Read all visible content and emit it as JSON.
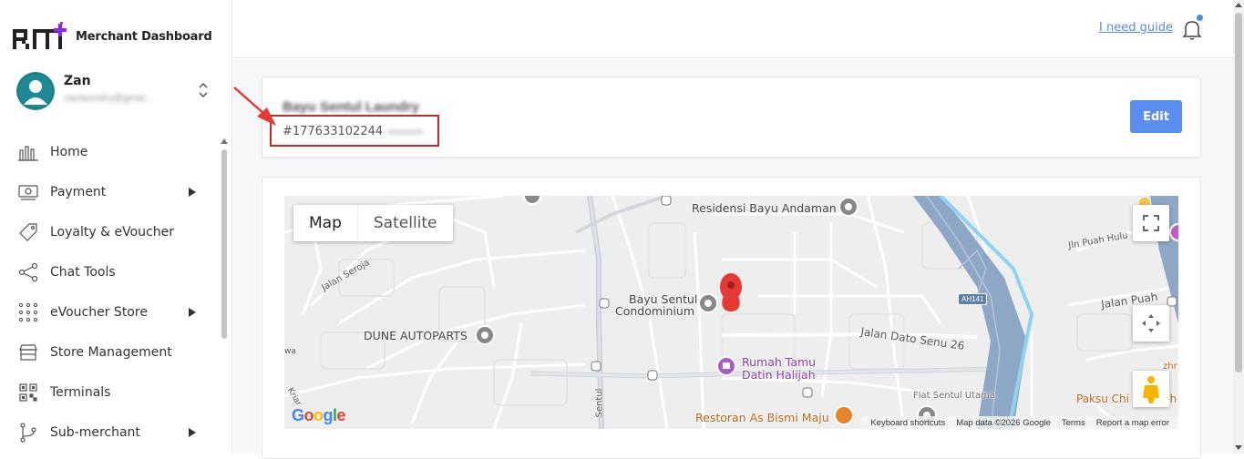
{
  "brand": {
    "logo_text": "RM",
    "name": "Merchant Dashboard"
  },
  "profile": {
    "name": "Zan",
    "email": "zanlaundry@gmai..."
  },
  "nav": [
    {
      "label": "Home",
      "icon": "chart-bars-icon",
      "has_caret": false
    },
    {
      "label": "Payment",
      "icon": "payment-icon",
      "has_caret": true
    },
    {
      "label": "Loyalty & eVoucher",
      "icon": "tag-icon",
      "has_caret": false
    },
    {
      "label": "Chat Tools",
      "icon": "share-icon",
      "has_caret": false
    },
    {
      "label": "eVoucher Store",
      "icon": "grid-dots-icon",
      "has_caret": true
    },
    {
      "label": "Store Management",
      "icon": "store-icon",
      "has_caret": false
    },
    {
      "label": "Terminals",
      "icon": "qr-icon",
      "has_caret": false
    },
    {
      "label": "Sub-merchant",
      "icon": "branch-icon",
      "has_caret": true
    }
  ],
  "header": {
    "guide_link": "I need guide",
    "notification_icon": "bell-icon"
  },
  "store": {
    "name": "Bayu Sentul Laundry",
    "id": "#177633102244",
    "id_suffix": "xxxxxxx",
    "edit_label": "Edit"
  },
  "map": {
    "types": [
      "Map",
      "Satellite"
    ],
    "selected_type": "Map",
    "labels": {
      "residensi": "Residensi Bayu Andaman",
      "jalan_seroja": "Jalan Seroja",
      "bayu_condo_1": "Bayu Sentul",
      "bayu_condo_2": "Condominium",
      "dune": "DUNE AUTOPARTS",
      "jalan_dato": "Jalan Dato Senu 26",
      "rumah_1": "Rumah Tamu",
      "rumah_2": "Datin Halijah",
      "restoran": "Restoran As Bismi Maju",
      "jalan_puah": "Jalan Puah",
      "jln_puah_hulu": "Jln Puah Hulu",
      "paksu": "Paksu Chi",
      "sentul": "Sentul",
      "ah141": "AH141",
      "kriar": "Kriar",
      "zhr": "zhr",
      "wa": "wa",
      "ch": "ch",
      "flat": "Flat Sentul Utama"
    },
    "footer": [
      "Keyboard shortcuts",
      "Map data ©2026 Google",
      "Terms",
      "Report a map error"
    ],
    "logo": "Google"
  },
  "colors": {
    "accent": "#5b8def",
    "highlight_box": "#c8262c",
    "pin": "#e53935",
    "river": "#8fd3f0",
    "highway": "#8fa7c7"
  }
}
